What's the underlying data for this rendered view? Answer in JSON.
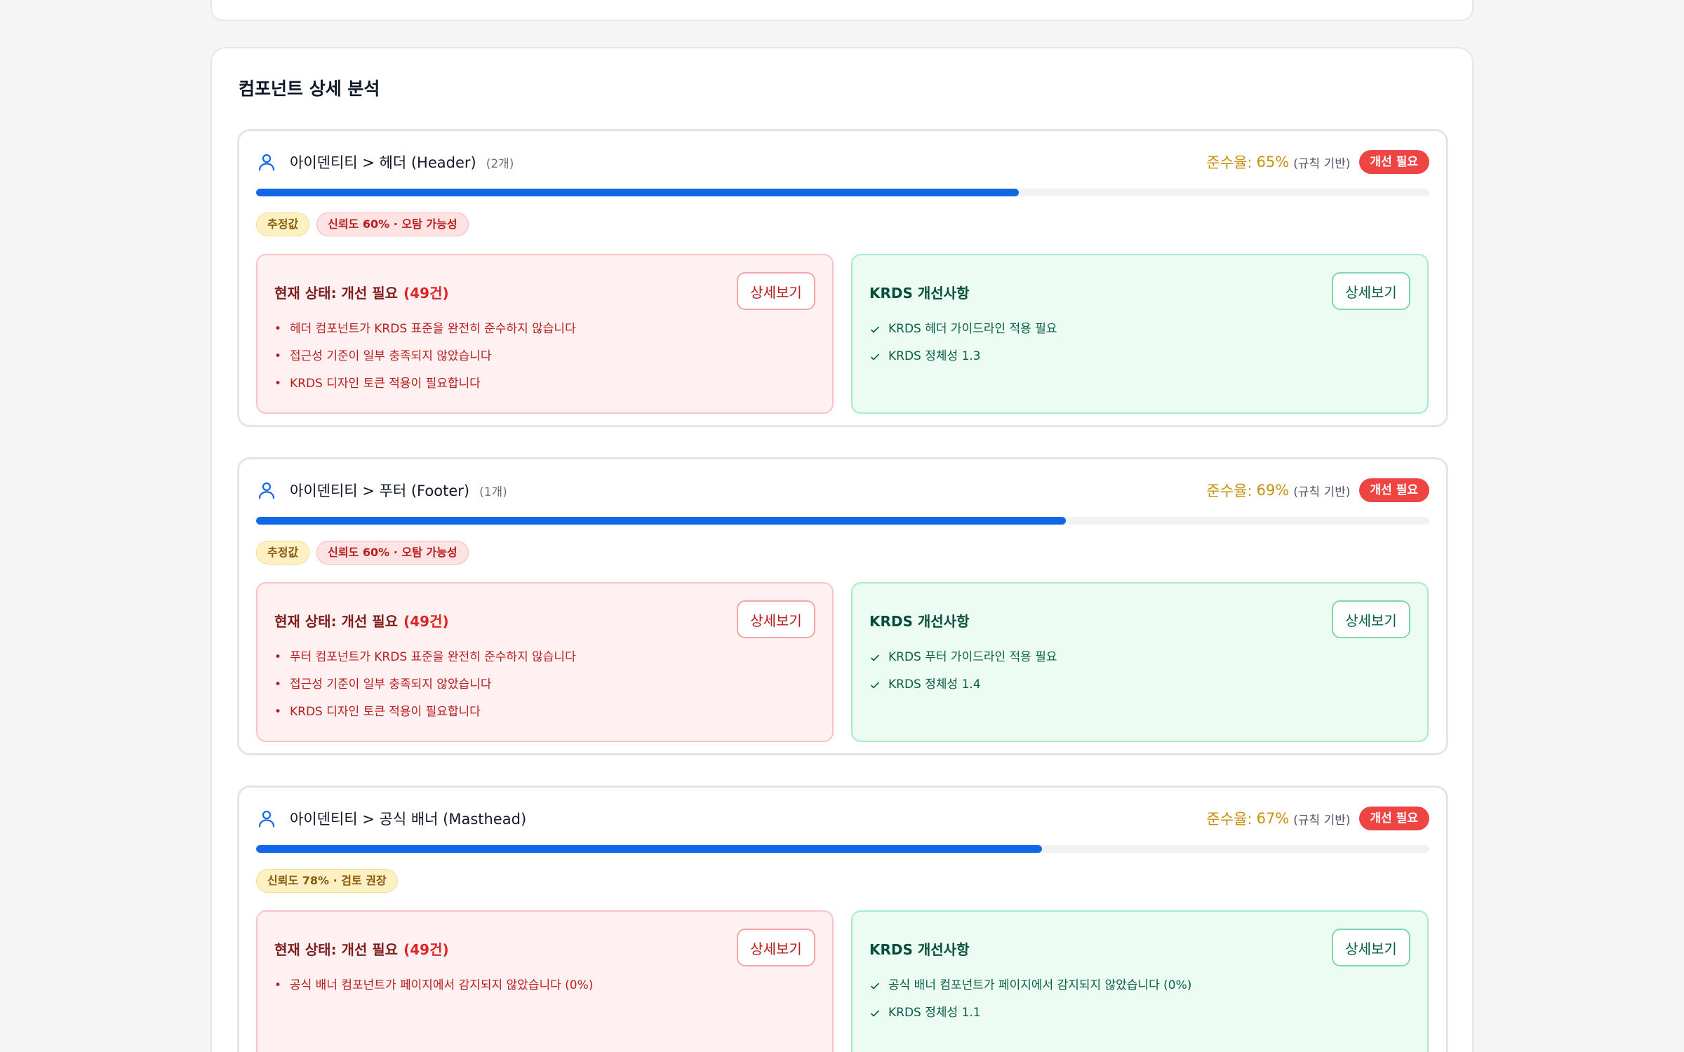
{
  "section": {
    "title": "컴포넌트 상세 분석"
  },
  "components": [
    {
      "name": "아이덴티티 > 헤더 (Header)",
      "count": "(2개)",
      "rate_label": "준수율:",
      "rate_value": "65%",
      "rate_basis": "(규칙 기반)",
      "status": "개선 필요",
      "progress": 0.65,
      "tags": [
        {
          "text": "추정값",
          "tone": "yellow"
        },
        {
          "text": "신뢰도 60% · 오탐 가능성",
          "tone": "red"
        }
      ],
      "current": {
        "title": "현재 상태: 개선 필요",
        "count": "(49건)",
        "button": "상세보기",
        "items": [
          "헤더 컴포넌트가 KRDS 표준을 완전히 준수하지 않습니다",
          "접근성 기준이 일부 충족되지 않았습니다",
          "KRDS 디자인 토큰 적용이 필요합니다"
        ]
      },
      "improve": {
        "title": "KRDS 개선사항",
        "button": "상세보기",
        "items": [
          "KRDS 헤더 가이드라인 적용 필요",
          "KRDS 정체성 1.3"
        ]
      }
    },
    {
      "name": "아이덴티티 > 푸터 (Footer)",
      "count": "(1개)",
      "rate_label": "준수율:",
      "rate_value": "69%",
      "rate_basis": "(규칙 기반)",
      "status": "개선 필요",
      "progress": 0.69,
      "tags": [
        {
          "text": "추정값",
          "tone": "yellow"
        },
        {
          "text": "신뢰도 60% · 오탐 가능성",
          "tone": "red"
        }
      ],
      "current": {
        "title": "현재 상태: 개선 필요",
        "count": "(49건)",
        "button": "상세보기",
        "items": [
          "푸터 컴포넌트가 KRDS 표준을 완전히 준수하지 않습니다",
          "접근성 기준이 일부 충족되지 않았습니다",
          "KRDS 디자인 토큰 적용이 필요합니다"
        ]
      },
      "improve": {
        "title": "KRDS 개선사항",
        "button": "상세보기",
        "items": [
          "KRDS 푸터 가이드라인 적용 필요",
          "KRDS 정체성 1.4"
        ]
      }
    },
    {
      "name": "아이덴티티 > 공식 배너 (Masthead)",
      "count": "",
      "rate_label": "준수율:",
      "rate_value": "67%",
      "rate_basis": "(규칙 기반)",
      "status": "개선 필요",
      "progress": 0.67,
      "tags": [
        {
          "text": "신뢰도 78% · 검토 권장",
          "tone": "yellow"
        }
      ],
      "current": {
        "title": "현재 상태: 개선 필요",
        "count": "(49건)",
        "button": "상세보기",
        "items": [
          "공식 배너 컴포넌트가 페이지에서 감지되지 않았습니다 (0%)"
        ]
      },
      "improve": {
        "title": "KRDS 개선사항",
        "button": "상세보기",
        "items": [
          "공식 배너 컴포넌트가 페이지에서 감지되지 않았습니다 (0%)",
          "KRDS 정체성 1.1"
        ]
      }
    }
  ]
}
